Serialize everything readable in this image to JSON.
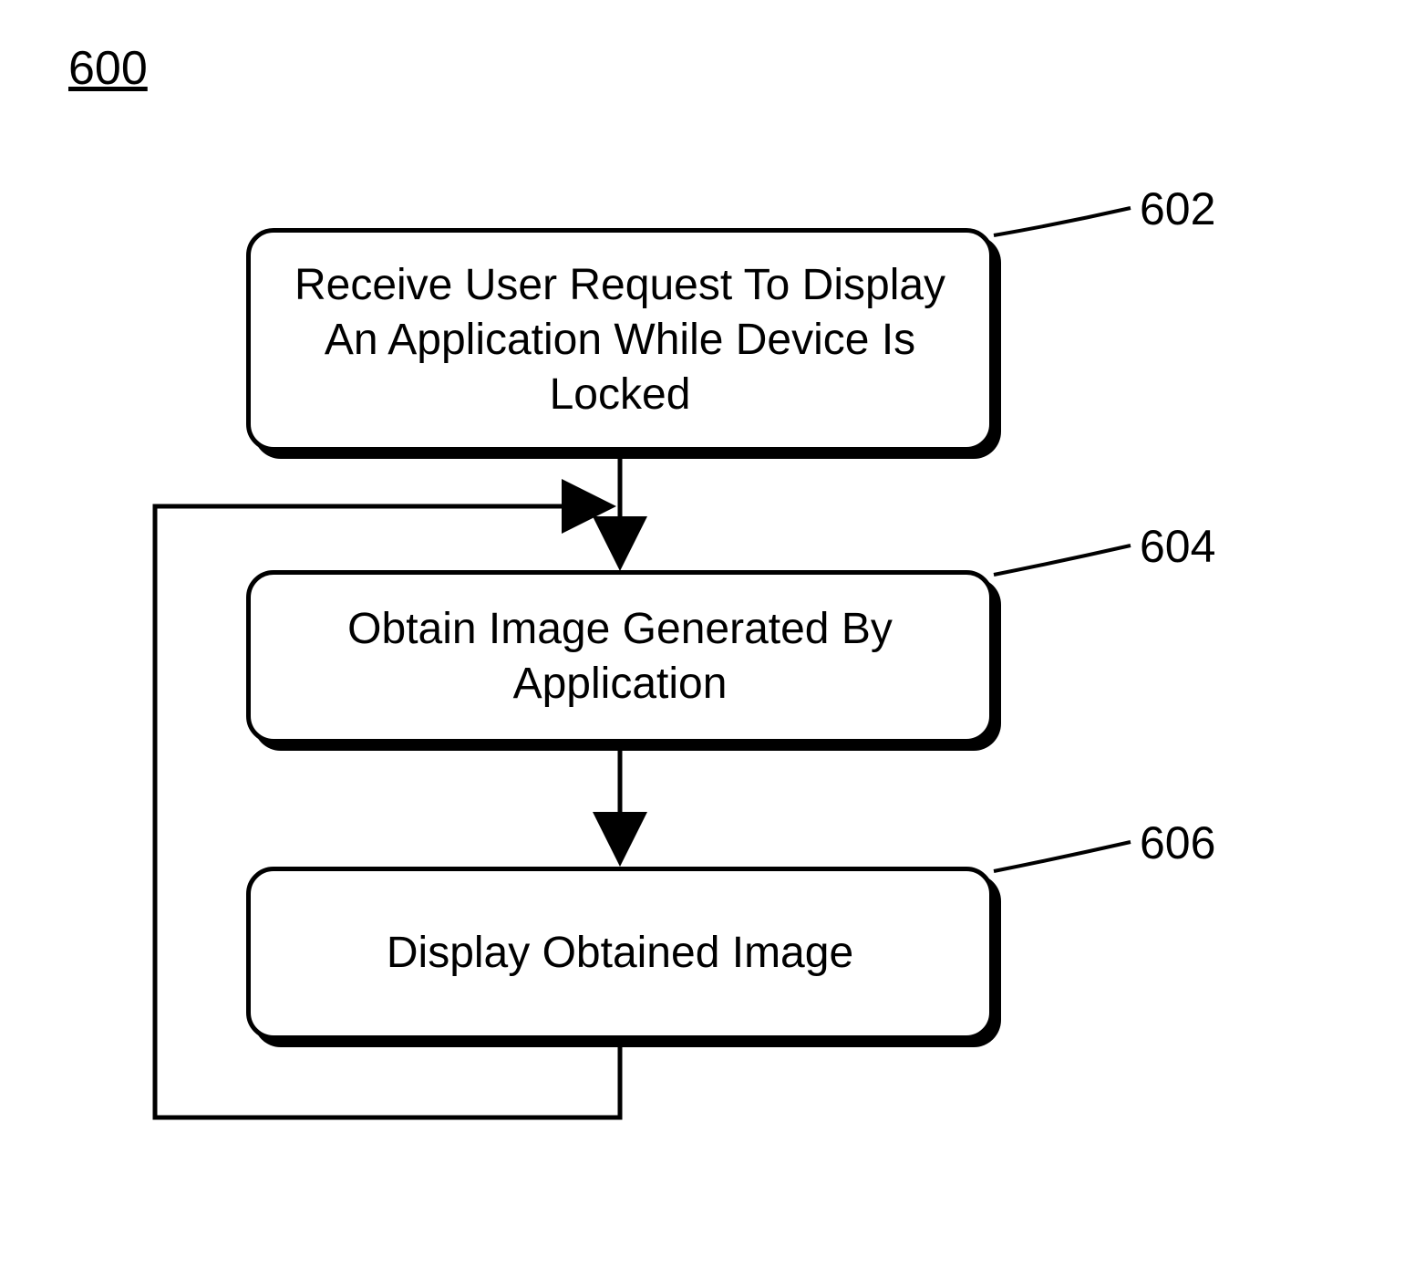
{
  "figure_number": "600",
  "boxes": {
    "step1": {
      "ref": "602",
      "text": "Receive User Request To Display An Application While Device Is Locked"
    },
    "step2": {
      "ref": "604",
      "text": "Obtain Image Generated By Application"
    },
    "step3": {
      "ref": "606",
      "text": "Display Obtained Image"
    }
  }
}
